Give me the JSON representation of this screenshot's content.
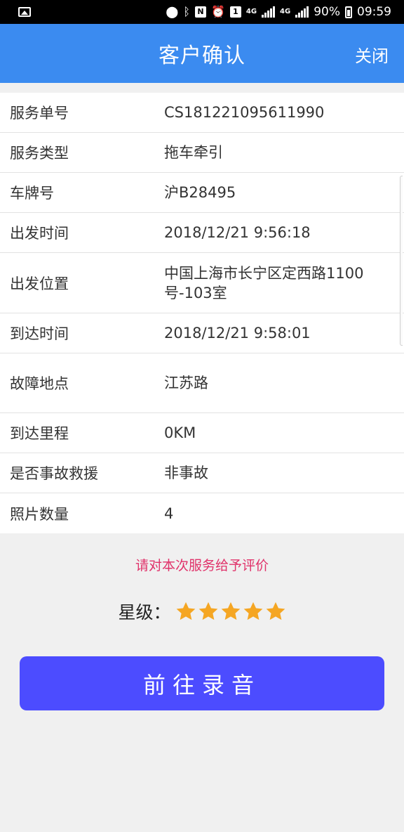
{
  "status_bar": {
    "network_4g_a": "4G",
    "network_4g_b": "4G",
    "battery": "90%",
    "time": "09:59",
    "icons": [
      "gallery-icon",
      "location-icon",
      "bluetooth-icon",
      "nfc-icon",
      "alarm-icon",
      "sim-icon",
      "signal-icon",
      "battery-icon"
    ]
  },
  "header": {
    "title": "客户确认",
    "close_label": "关闭",
    "color": "#3b8bf0"
  },
  "info_rows": [
    {
      "label": "服务单号",
      "value": "CS181221095611990"
    },
    {
      "label": "服务类型",
      "value": "拖车牵引"
    },
    {
      "label": "车牌号",
      "value": "沪B28495"
    },
    {
      "label": "出发时间",
      "value": "2018/12/21 9:56:18"
    },
    {
      "label": "出发位置",
      "value": "中国上海市长宁区定西路1100号-103室"
    },
    {
      "label": "到达时间",
      "value": "2018/12/21 9:58:01"
    },
    {
      "label": "故障地点",
      "value": "江苏路"
    },
    {
      "label": "到达里程",
      "value": "0KM"
    },
    {
      "label": "是否事故救援",
      "value": "非事故"
    },
    {
      "label": "照片数量",
      "value": "4"
    }
  ],
  "rating": {
    "prompt": "请对本次服务给予评价",
    "label": "星级：",
    "stars_filled": 5,
    "stars_total": 5,
    "star_color": "#f5a623",
    "prompt_color": "#e0326a"
  },
  "record_button": {
    "label": "前往录音",
    "color": "#4c4cff"
  }
}
